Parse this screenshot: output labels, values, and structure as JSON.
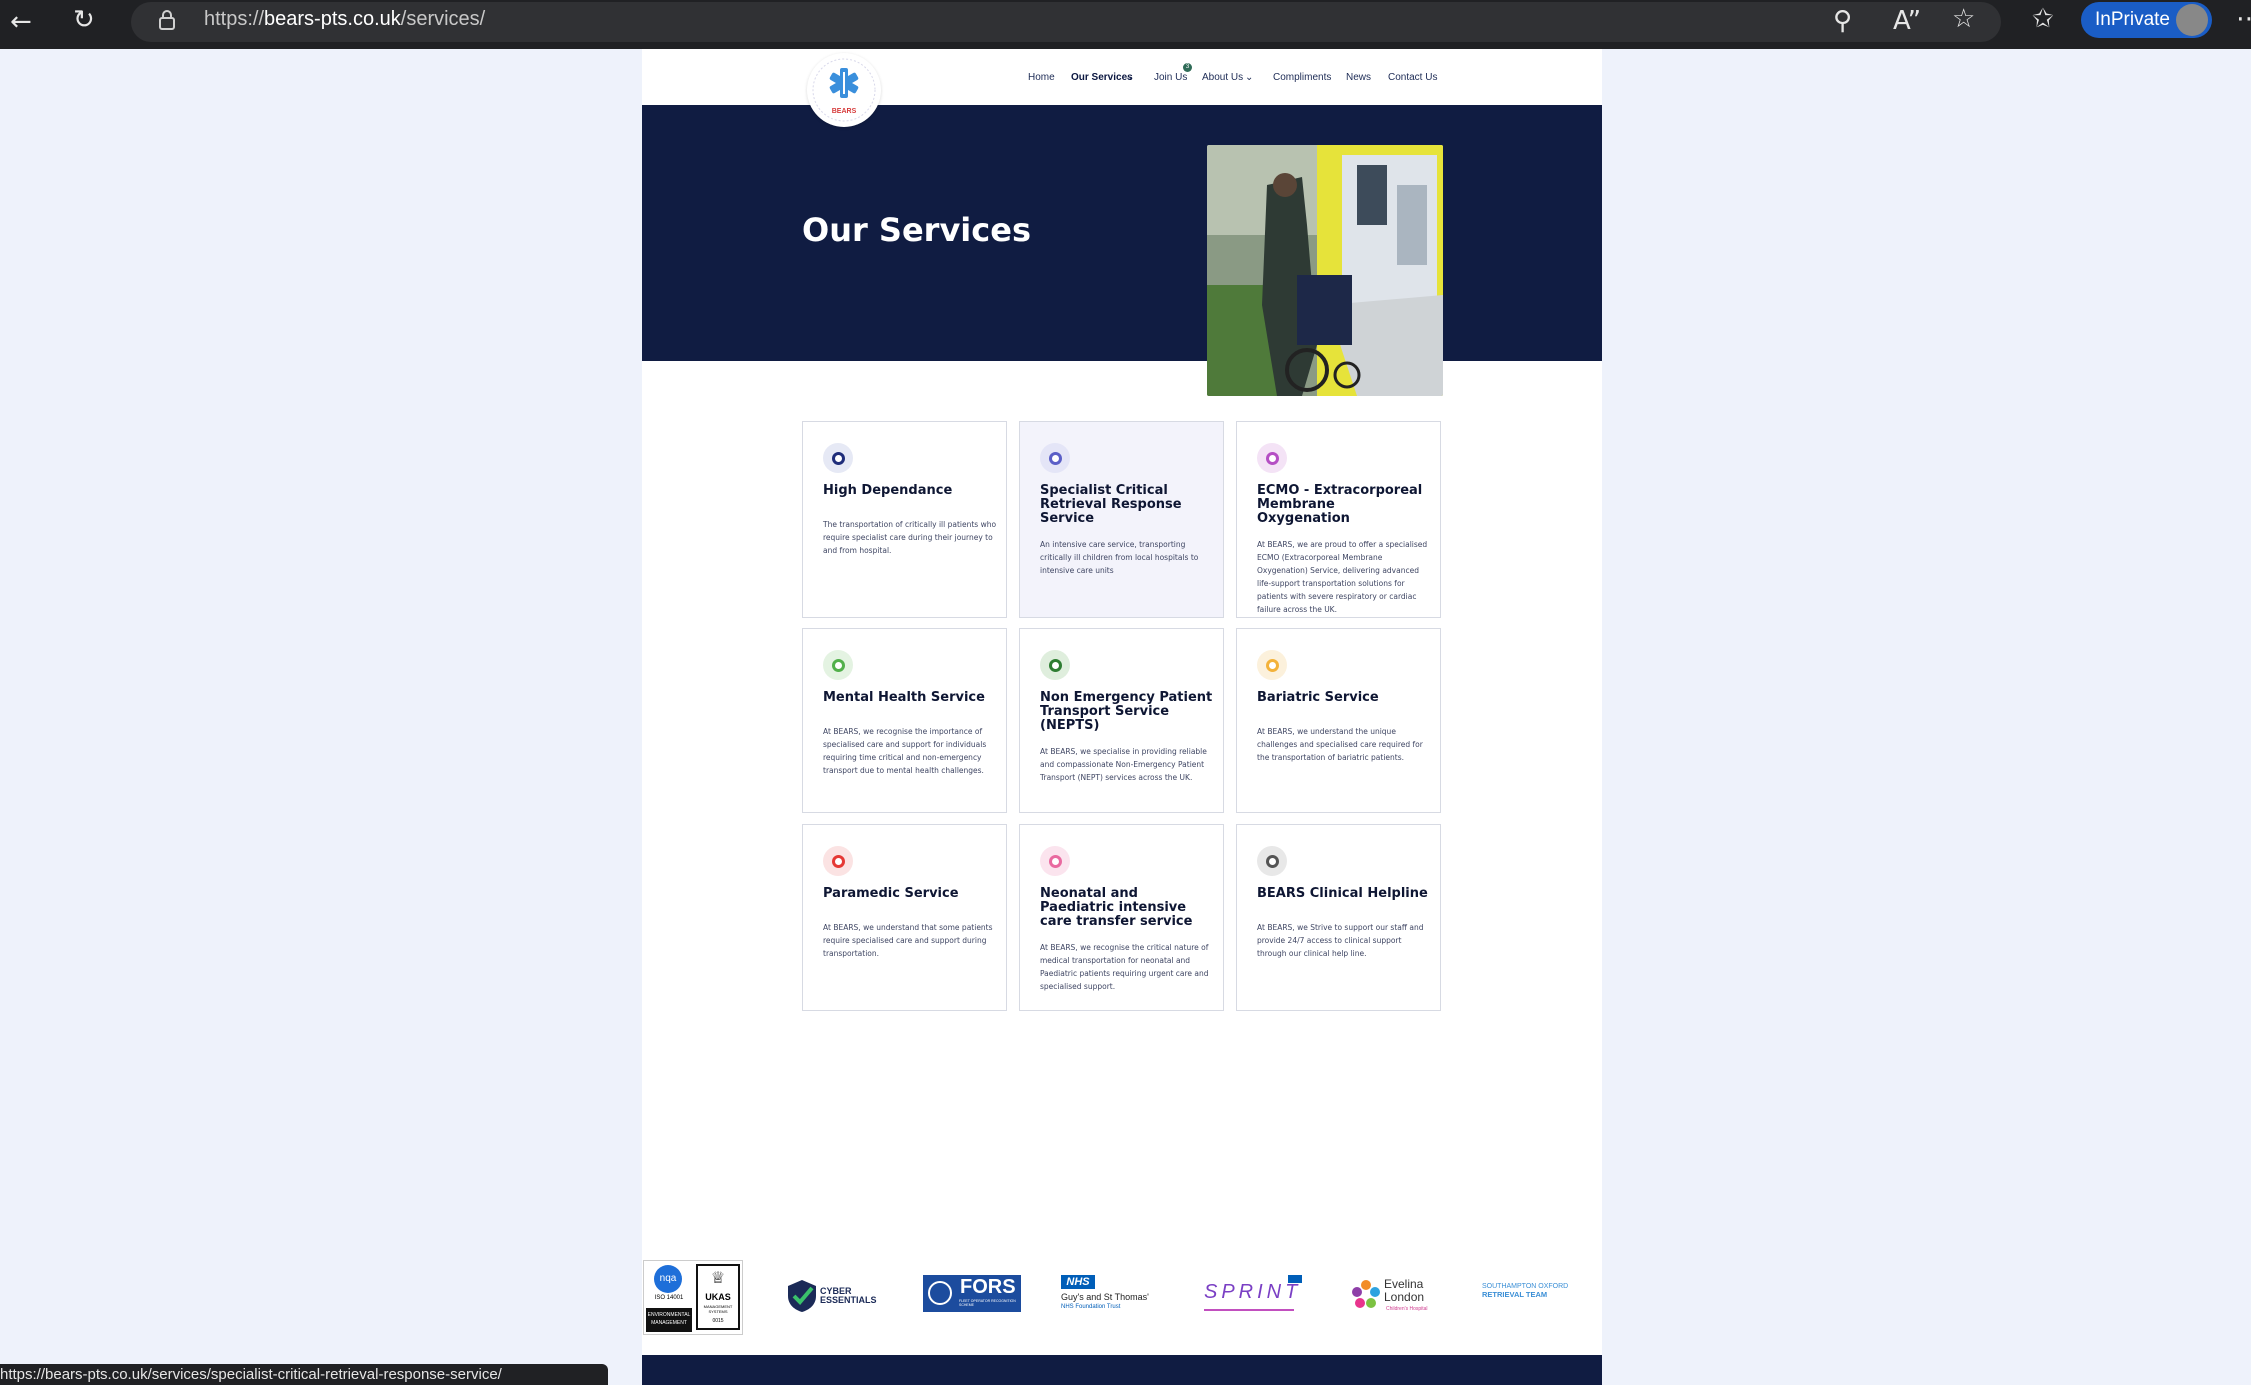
{
  "browser": {
    "url_scheme": "https://",
    "url_host": "bears-pts.co.uk",
    "url_path": "/services/",
    "inprivate_label": "InPrivate",
    "status_url": "https://bears-pts.co.uk/services/specialist-critical-retrieval-response-service/"
  },
  "site": {
    "logo_text": "BEARS",
    "nav": [
      {
        "label": "Home"
      },
      {
        "label": "Our Services"
      },
      {
        "label": "Join Us",
        "badge": "3"
      },
      {
        "label": "About Us"
      },
      {
        "label": "Compliments"
      },
      {
        "label": "News"
      },
      {
        "label": "Contact Us"
      }
    ],
    "hero_title": "Our Services"
  },
  "services": [
    {
      "title": "High Dependance",
      "desc": "The transportation of critically ill patients who require specialist care during their journey to and from hospital.",
      "color": "#1f2d7a",
      "bg": "#e6e9f5"
    },
    {
      "title": "Specialist Critical Retrieval Response Service",
      "desc": "An intensive care service, transporting critically ill children from local hospitals to intensive care units",
      "color": "#5b5fc7",
      "bg": "#e4e5f7"
    },
    {
      "title": "ECMO - Extracorporeal Membrane Oxygenation",
      "desc": "At BEARS, we are proud to offer a specialised ECMO (Extracorporeal Membrane Oxygenation) Service, delivering advanced life-support transportation solutions for patients with severe respiratory or cardiac failure across the UK.",
      "color": "#b54fc4",
      "bg": "#f4e3f6"
    },
    {
      "title": "Mental Health Service",
      "desc": "At BEARS, we recognise the importance of specialised care and support for individuals requiring time critical and non-emergency transport due to mental health challenges.",
      "color": "#52b04b",
      "bg": "#e4f3e2"
    },
    {
      "title": "Non Emergency Patient Transport Service (NEPTS)",
      "desc": "At BEARS, we specialise in providing reliable and compassionate Non-Emergency Patient Transport (NEPT) services across the UK.",
      "color": "#2e7d32",
      "bg": "#dfeedd"
    },
    {
      "title": "Bariatric Service",
      "desc": "At BEARS, we understand the unique challenges and specialised care required for the transportation of bariatric patients.",
      "color": "#f3b23a",
      "bg": "#fcf1dc"
    },
    {
      "title": "Paramedic Service",
      "desc": "At BEARS, we understand that some patients require specialised care and support during transportation.",
      "color": "#e53935",
      "bg": "#fbe3e3"
    },
    {
      "title": "Neonatal and Paediatric intensive care transfer service",
      "desc": "At BEARS, we recognise the critical nature of medical transportation for neonatal and Paediatric patients requiring urgent care and specialised support.",
      "color": "#e96aa0",
      "bg": "#fbe4ee"
    },
    {
      "title": "BEARS Clinical Helpline",
      "desc": "At BEARS, we Strive to support our staff and provide 24/7 access to clinical support through our clinical help line.",
      "color": "#555555",
      "bg": "#e8e8e8"
    }
  ],
  "partners": {
    "nqa_top": "nqa",
    "nqa_iso": "ISO 14001",
    "nqa_env": "ENVIRONMENTAL MANAGEMENT",
    "ukas": "UKAS",
    "ukas_sub": "MANAGEMENT SYSTEMS",
    "ukas_num": "0015",
    "cyber": "CYBER ESSENTIALS",
    "fors": "FORS",
    "fors_sub": "FLEET OPERATOR RECOGNITION SCHEME",
    "nhs": "NHS",
    "guys": "Guy's and St Thomas'",
    "guys_sub": "NHS Foundation Trust",
    "sprint": "SPRINT",
    "evelina": "Evelina London",
    "evelina_sub": "Children's Hospital",
    "soton_1": "SOUTHAMPTON OXFORD",
    "soton_2": "RETRIEVAL TEAM"
  }
}
